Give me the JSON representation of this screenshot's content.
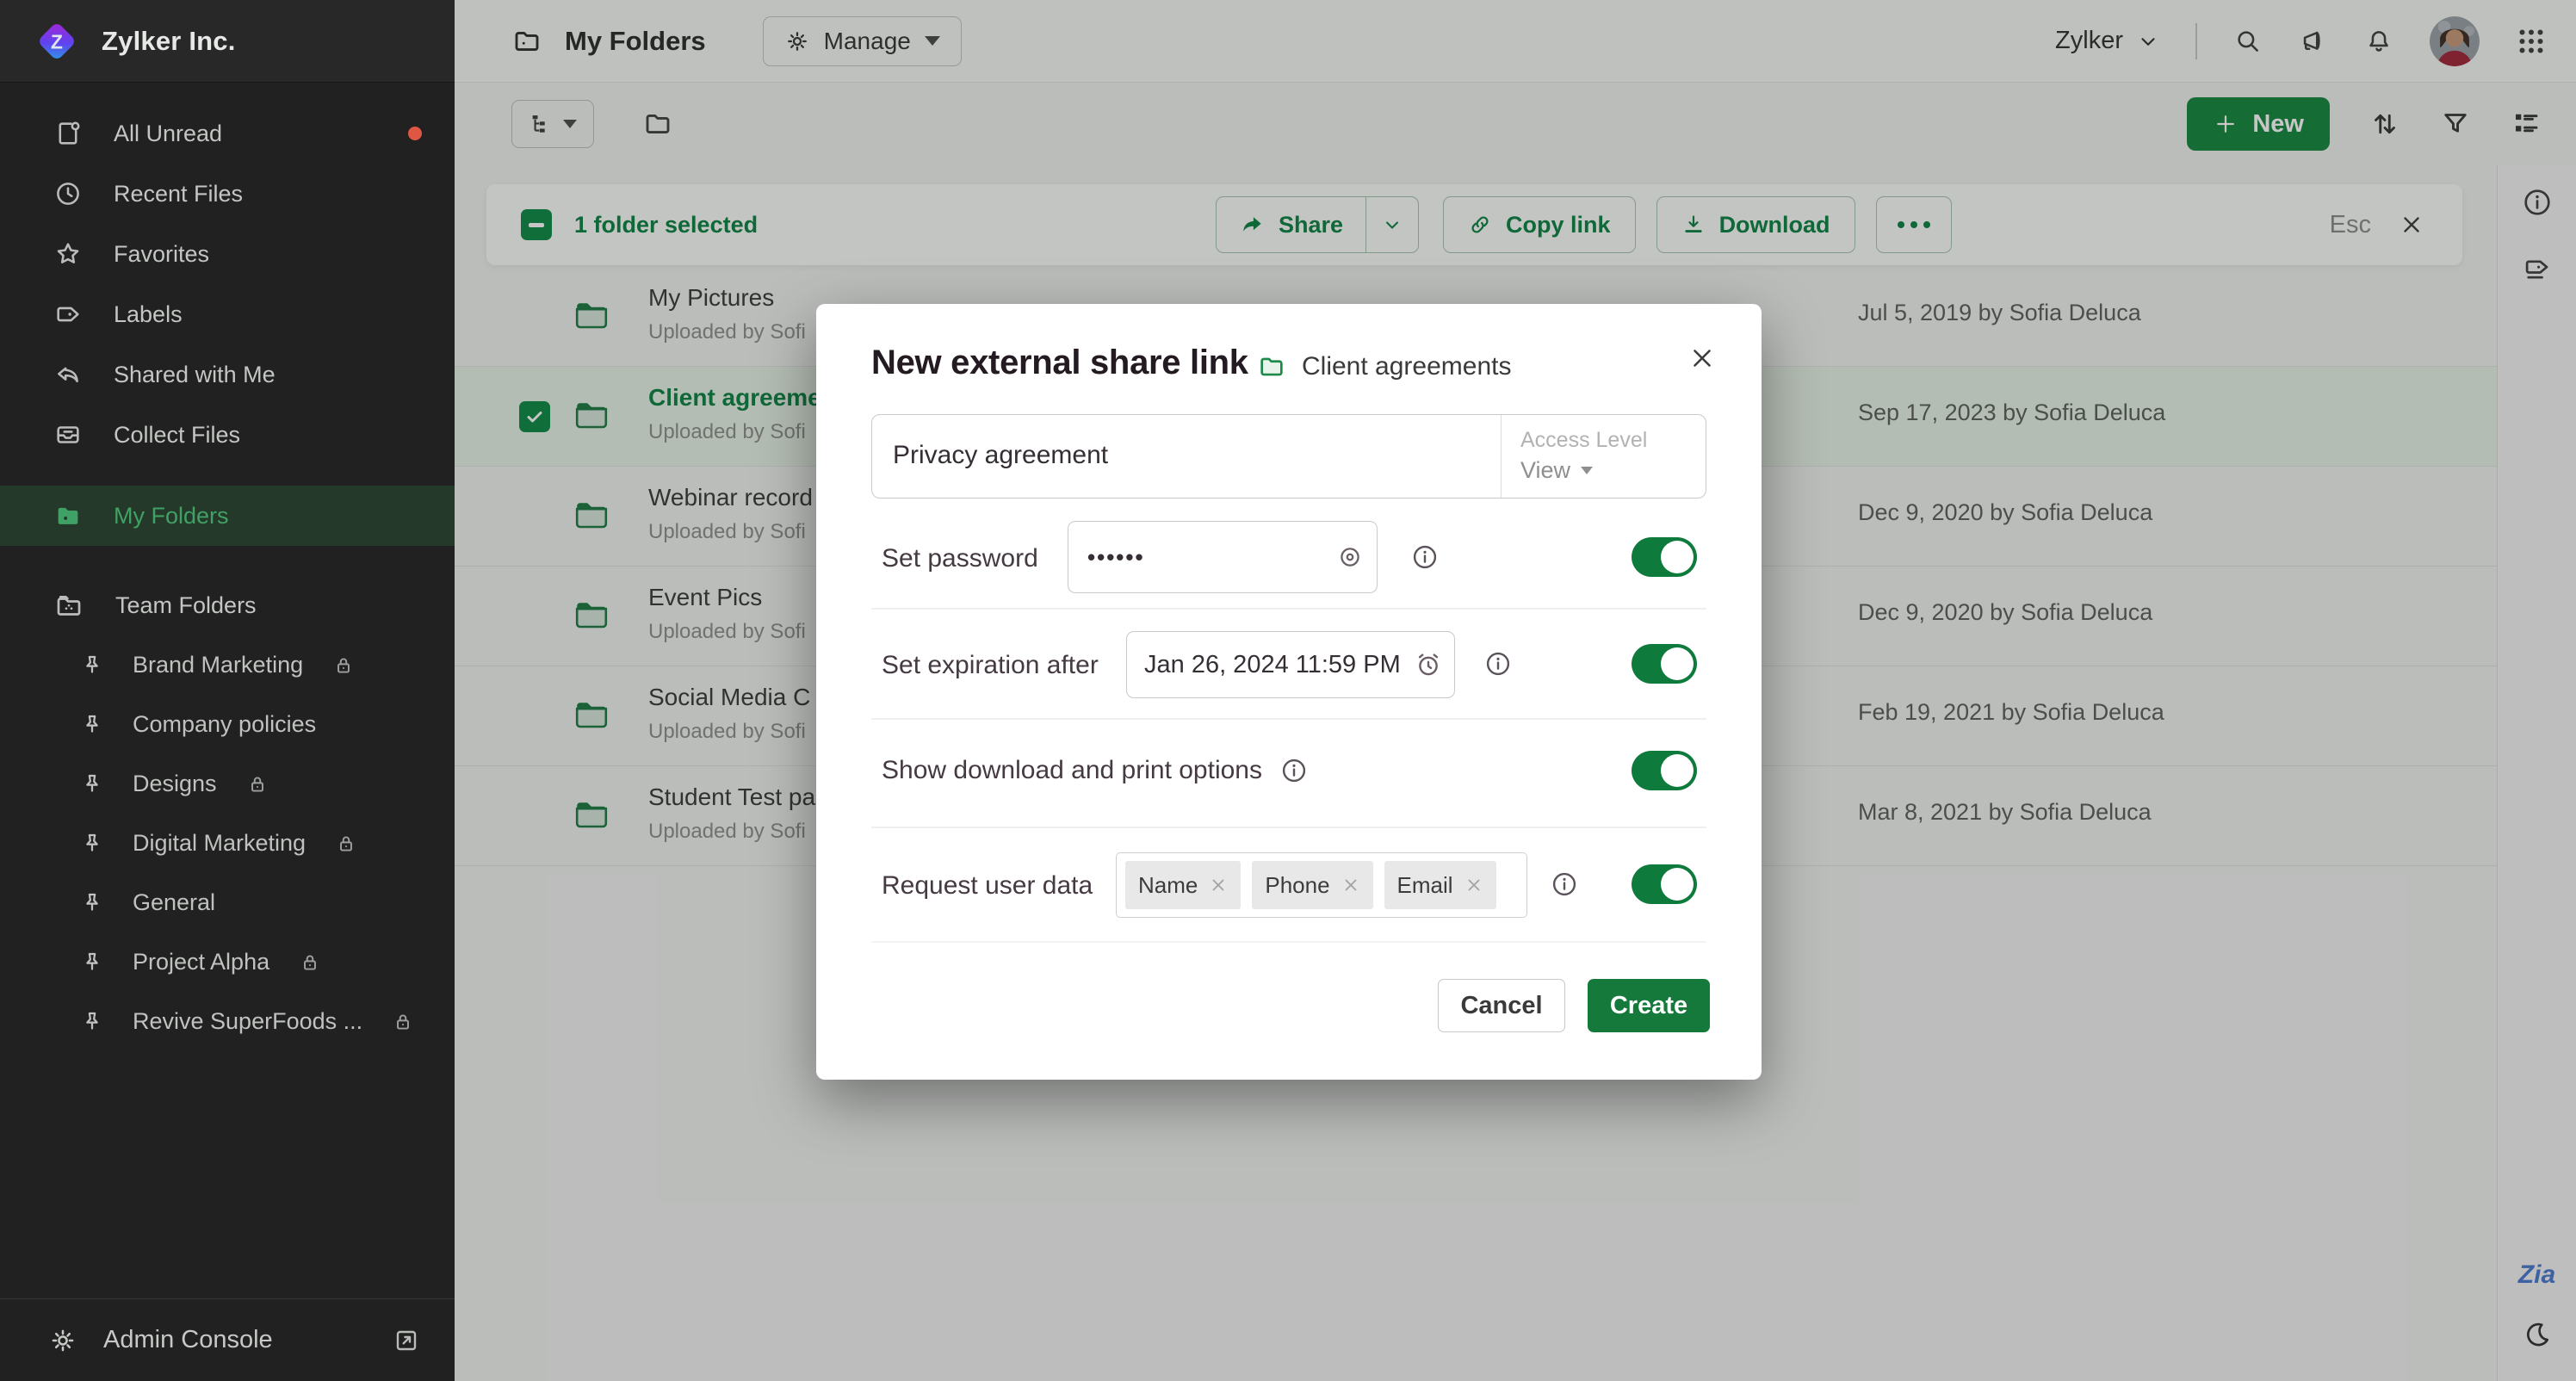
{
  "colors": {
    "accent_green": "#0E7A3C",
    "sidebar_active_green": "#41A164",
    "selection_green": "#0D8243",
    "new_button_green": "#15873F",
    "create_button_green": "#14793A",
    "badge_red": "#DD5742",
    "zia_blue": "#4A78D0"
  },
  "brand": {
    "company_name": "Zylker Inc."
  },
  "sidebar": {
    "items": [
      {
        "label": "All Unread",
        "has_badge": true
      },
      {
        "label": "Recent Files"
      },
      {
        "label": "Favorites"
      },
      {
        "label": "Labels"
      },
      {
        "label": "Shared with Me"
      },
      {
        "label": "Collect Files"
      },
      {
        "label": "My Folders",
        "active": true
      }
    ],
    "team": {
      "label": "Team Folders",
      "folders": [
        {
          "label": "Brand Marketing",
          "locked": true
        },
        {
          "label": "Company policies",
          "locked": false
        },
        {
          "label": "Designs",
          "locked": true
        },
        {
          "label": "Digital Marketing",
          "locked": true
        },
        {
          "label": "General",
          "locked": false
        },
        {
          "label": "Project Alpha",
          "locked": true
        },
        {
          "label": "Revive SuperFoods ...",
          "locked": true
        }
      ]
    },
    "admin_console_label": "Admin Console"
  },
  "topbar": {
    "page_title": "My Folders",
    "manage_label": "Manage",
    "org_switcher": "Zylker"
  },
  "actions_bar": {
    "new_button_label": "New"
  },
  "selection_bar": {
    "selected_text": "1 folder selected",
    "share_label": "Share",
    "copy_link_label": "Copy link",
    "download_label": "Download",
    "esc_label": "Esc"
  },
  "file_list": {
    "rows": [
      {
        "name": "My Pictures",
        "subtitle": "Uploaded by Sofi",
        "date": "Jul 5, 2019 by Sofia Deluca",
        "selected": false
      },
      {
        "name": "Client agreeme",
        "subtitle": "Uploaded by Sofi",
        "date": "Sep 17, 2023 by Sofia Deluca",
        "selected": true
      },
      {
        "name": "Webinar record",
        "subtitle": "Uploaded by Sofi",
        "date": "Dec 9, 2020 by Sofia Deluca",
        "selected": false
      },
      {
        "name": "Event Pics",
        "subtitle": "Uploaded by Sofi",
        "date": "Dec 9, 2020 by Sofia Deluca",
        "selected": false
      },
      {
        "name": "Social Media C",
        "subtitle": "Uploaded by Sofi",
        "date": "Feb 19, 2021 by Sofia Deluca",
        "selected": false
      },
      {
        "name": "Student Test pa",
        "subtitle": "Uploaded by Sofi",
        "date": "Mar 8, 2021 by Sofia Deluca",
        "selected": false
      }
    ]
  },
  "modal": {
    "title": "New external share link",
    "context_folder": "Client agreements",
    "link_name_value": "Privacy agreement",
    "access_level_label": "Access Level",
    "access_level_value": "View",
    "password": {
      "label": "Set password",
      "value": "••••••"
    },
    "expiration": {
      "label": "Set expiration after",
      "value": "Jan 26, 2024 11:59 PM"
    },
    "download_print": {
      "label": "Show download and print options"
    },
    "request_user_data": {
      "label": "Request user data",
      "chips": [
        "Name",
        "Phone",
        "Email"
      ]
    },
    "cancel_label": "Cancel",
    "create_label": "Create"
  },
  "zia_label": "Zia"
}
